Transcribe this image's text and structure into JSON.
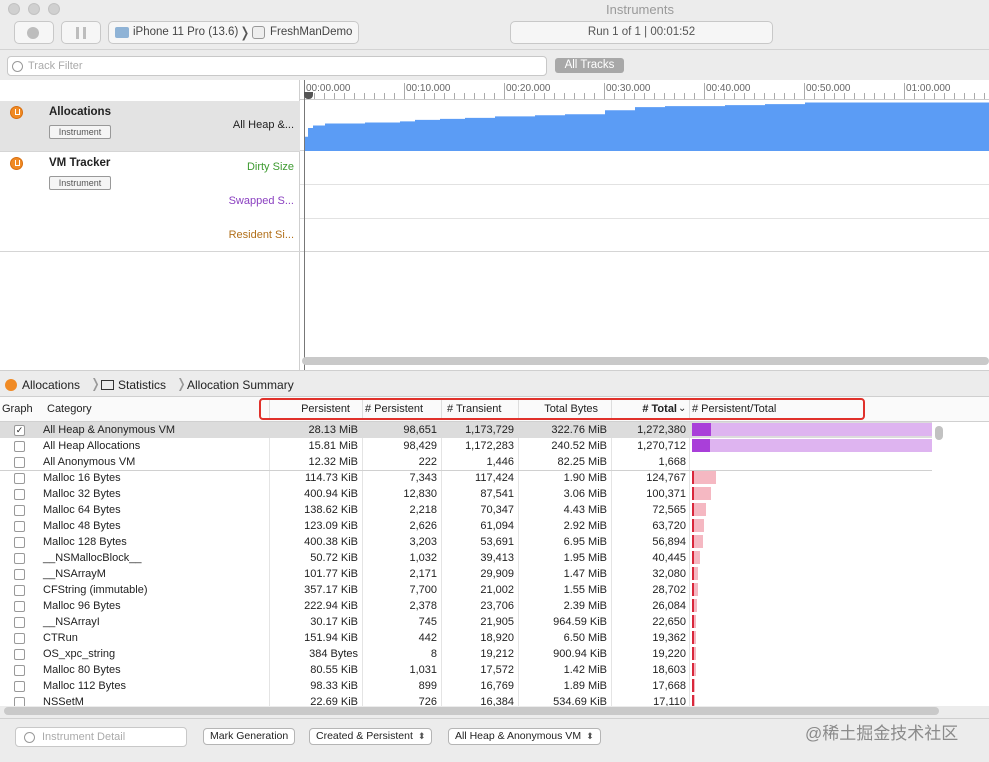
{
  "window": {
    "title": "Instruments"
  },
  "toolbar": {
    "device": "iPhone 11 Pro (13.6)",
    "app": "FreshManDemo",
    "run_status": "Run 1 of 1  |  00:01:52"
  },
  "filter": {
    "placeholder": "Track Filter",
    "all_tracks": "All Tracks"
  },
  "tracks": [
    {
      "name": "Allocations",
      "badge": "Instrument",
      "subs": [
        {
          "label": "All Heap &...",
          "color": "#222222"
        }
      ]
    },
    {
      "name": "VM Tracker",
      "badge": "Instrument",
      "subs": [
        {
          "label": "Dirty Size",
          "color": "#3c9a2f"
        },
        {
          "label": "Swapped S...",
          "color": "#8a3fc0"
        },
        {
          "label": "Resident Si...",
          "color": "#b2701a"
        }
      ]
    }
  ],
  "ruler": [
    "00:00.000",
    "00:10.000",
    "00:20.000",
    "00:30.000",
    "00:40.000",
    "00:50.000",
    "01:00.000"
  ],
  "breadcrumb": [
    "Allocations",
    "Statistics",
    "Allocation Summary"
  ],
  "table": {
    "headers": {
      "graph": "Graph",
      "category": "Category",
      "persistent": "Persistent",
      "n_persistent": "# Persistent",
      "n_transient": "# Transient",
      "total_bytes": "Total Bytes",
      "n_total": "# Total",
      "ratio": "# Persistent/Total"
    },
    "sort_indicator": "⌄",
    "rows": [
      {
        "checked": true,
        "category": "All Heap & Anonymous VM",
        "persistent": "28.13 MiB",
        "n_persistent": "98,651",
        "n_transient": "1,173,729",
        "total_bytes": "322.76 MiB",
        "n_total": "1,272,380",
        "ratio": 0.078,
        "scale": 1.0,
        "color": "#a93fd9",
        "track": "#deb4f0"
      },
      {
        "checked": false,
        "category": "All Heap Allocations",
        "persistent": "15.81 MiB",
        "n_persistent": "98,429",
        "n_transient": "1,172,283",
        "total_bytes": "240.52 MiB",
        "n_total": "1,270,712",
        "ratio": 0.077,
        "scale": 1.0,
        "color": "#a93fd9",
        "track": "#deb4f0"
      },
      {
        "checked": false,
        "category": "All Anonymous VM",
        "persistent": "12.32 MiB",
        "n_persistent": "222",
        "n_transient": "1,446",
        "total_bytes": "82.25 MiB",
        "n_total": "1,668",
        "ratio": 0.13,
        "scale": 0,
        "color": "#a93fd9",
        "track": "#deb4f0"
      },
      {
        "checked": false,
        "category": "Malloc 16 Bytes",
        "persistent": "114.73 KiB",
        "n_persistent": "7,343",
        "n_transient": "117,424",
        "total_bytes": "1.90 MiB",
        "n_total": "124,767",
        "ratio": 0.059,
        "scale": 0.098,
        "color": "#d9283c",
        "track": "#f5b8c2"
      },
      {
        "checked": false,
        "category": "Malloc 32 Bytes",
        "persistent": "400.94 KiB",
        "n_persistent": "12,830",
        "n_transient": "87,541",
        "total_bytes": "3.06 MiB",
        "n_total": "100,371",
        "ratio": 0.128,
        "scale": 0.079,
        "color": "#d9283c",
        "track": "#f5b8c2"
      },
      {
        "checked": false,
        "category": "Malloc 64 Bytes",
        "persistent": "138.62 KiB",
        "n_persistent": "2,218",
        "n_transient": "70,347",
        "total_bytes": "4.43 MiB",
        "n_total": "72,565",
        "ratio": 0.031,
        "scale": 0.057,
        "color": "#d9283c",
        "track": "#f5b8c2"
      },
      {
        "checked": false,
        "category": "Malloc 48 Bytes",
        "persistent": "123.09 KiB",
        "n_persistent": "2,626",
        "n_transient": "61,094",
        "total_bytes": "2.92 MiB",
        "n_total": "63,720",
        "ratio": 0.041,
        "scale": 0.05,
        "color": "#d9283c",
        "track": "#f5b8c2"
      },
      {
        "checked": false,
        "category": "Malloc 128 Bytes",
        "persistent": "400.38 KiB",
        "n_persistent": "3,203",
        "n_transient": "53,691",
        "total_bytes": "6.95 MiB",
        "n_total": "56,894",
        "ratio": 0.056,
        "scale": 0.045,
        "color": "#d9283c",
        "track": "#f5b8c2"
      },
      {
        "checked": false,
        "category": "__NSMallocBlock__",
        "persistent": "50.72 KiB",
        "n_persistent": "1,032",
        "n_transient": "39,413",
        "total_bytes": "1.95 MiB",
        "n_total": "40,445",
        "ratio": 0.026,
        "scale": 0.032,
        "color": "#d9283c",
        "track": "#f5b8c2"
      },
      {
        "checked": false,
        "category": "__NSArrayM",
        "persistent": "101.77 KiB",
        "n_persistent": "2,171",
        "n_transient": "29,909",
        "total_bytes": "1.47 MiB",
        "n_total": "32,080",
        "ratio": 0.068,
        "scale": 0.025,
        "color": "#d9283c",
        "track": "#f5b8c2"
      },
      {
        "checked": false,
        "category": "CFString (immutable)",
        "persistent": "357.17 KiB",
        "n_persistent": "7,700",
        "n_transient": "21,002",
        "total_bytes": "1.55 MiB",
        "n_total": "28,702",
        "ratio": 0.268,
        "scale": 0.023,
        "color": "#d9283c",
        "track": "#f5b8c2"
      },
      {
        "checked": false,
        "category": "Malloc 96 Bytes",
        "persistent": "222.94 KiB",
        "n_persistent": "2,378",
        "n_transient": "23,706",
        "total_bytes": "2.39 MiB",
        "n_total": "26,084",
        "ratio": 0.091,
        "scale": 0.021,
        "color": "#d9283c",
        "track": "#f5b8c2"
      },
      {
        "checked": false,
        "category": "__NSArrayI",
        "persistent": "30.17 KiB",
        "n_persistent": "745",
        "n_transient": "21,905",
        "total_bytes": "964.59 KiB",
        "n_total": "22,650",
        "ratio": 0.033,
        "scale": 0.018,
        "color": "#d9283c",
        "track": "#f5b8c2"
      },
      {
        "checked": false,
        "category": "CTRun",
        "persistent": "151.94 KiB",
        "n_persistent": "442",
        "n_transient": "18,920",
        "total_bytes": "6.50 MiB",
        "n_total": "19,362",
        "ratio": 0.023,
        "scale": 0.015,
        "color": "#d9283c",
        "track": "#f5b8c2"
      },
      {
        "checked": false,
        "category": "OS_xpc_string",
        "persistent": "384 Bytes",
        "n_persistent": "8",
        "n_transient": "19,212",
        "total_bytes": "900.94 KiB",
        "n_total": "19,220",
        "ratio": 0.0004,
        "scale": 0.015,
        "color": "#d9283c",
        "track": "#f5b8c2"
      },
      {
        "checked": false,
        "category": "Malloc 80 Bytes",
        "persistent": "80.55 KiB",
        "n_persistent": "1,031",
        "n_transient": "17,572",
        "total_bytes": "1.42 MiB",
        "n_total": "18,603",
        "ratio": 0.055,
        "scale": 0.015,
        "color": "#d9283c",
        "track": "#f5b8c2"
      },
      {
        "checked": false,
        "category": "Malloc 112 Bytes",
        "persistent": "98.33 KiB",
        "n_persistent": "899",
        "n_transient": "16,769",
        "total_bytes": "1.89 MiB",
        "n_total": "17,668",
        "ratio": 0.051,
        "scale": 0.014,
        "color": "#d9283c",
        "track": "#f5b8c2"
      },
      {
        "checked": false,
        "category": "NSSetM",
        "persistent": "22.69 KiB",
        "n_persistent": "726",
        "n_transient": "16,384",
        "total_bytes": "534.69 KiB",
        "n_total": "17,110",
        "ratio": 0.042,
        "scale": 0.013,
        "color": "#d9283c",
        "track": "#f5b8c2"
      }
    ]
  },
  "bottom": {
    "detail_placeholder": "Instrument Detail",
    "mark_generation": "Mark Generation",
    "lifespan": "Created & Persistent",
    "allocation_type": "All Heap & Anonymous VM"
  },
  "watermark": "@稀土掘金技术社区",
  "colors": {
    "graph_fill": "#5b9cf5",
    "highlight": "#e0312b"
  }
}
